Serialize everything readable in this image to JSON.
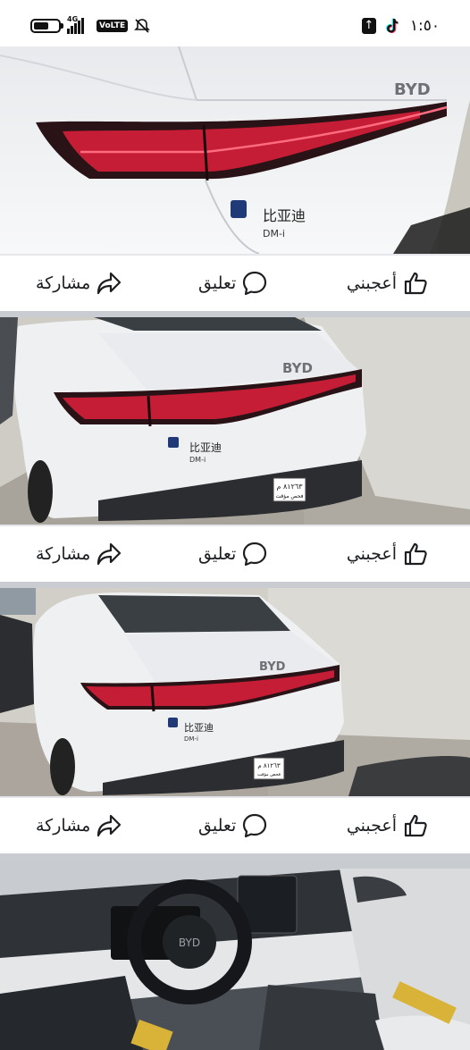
{
  "status_bar": {
    "time": "١:٥٠",
    "network": "4G",
    "volte": "VoLTE",
    "battery_level": 0.6
  },
  "posts": [
    {
      "actions": {
        "like": "أعجبني",
        "comment": "تعليق",
        "share": "مشاركة"
      },
      "photo": {
        "brand_badge": "BYD",
        "plate_text": "",
        "model_text": "DM-i",
        "chinese_text": "比亚迪"
      }
    },
    {
      "actions": {
        "like": "أعجبني",
        "comment": "تعليق",
        "share": "مشاركة"
      },
      "photo": {
        "brand_badge": "BYD",
        "plate_text": "٨١٢٦٣ م",
        "plate_sub": "فحص مؤقت",
        "model_text": "DM-i",
        "chinese_text": "比亚迪"
      }
    },
    {
      "actions": {
        "like": "أعجبني",
        "comment": "تعليق",
        "share": "مشاركة"
      },
      "photo": {
        "brand_badge": "BYD",
        "plate_text": "٨١٢٦٣ م",
        "plate_sub": "فحص مؤقت",
        "model_text": "DM-i",
        "chinese_text": "比亚迪"
      }
    }
  ],
  "colors": {
    "accent": "#1877f2",
    "tail_light": "#e0203c",
    "car_body": "#f1f2f4",
    "feed_bg": "#c9ccd1"
  },
  "icons": {
    "like": "thumbs-up-icon",
    "comment": "speech-bubble-icon",
    "share": "share-arrow-icon"
  }
}
